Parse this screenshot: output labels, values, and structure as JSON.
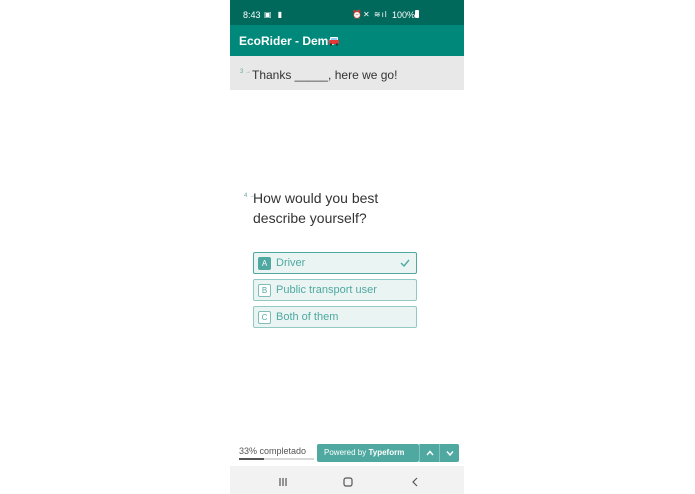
{
  "status_bar": {
    "time": "8:43",
    "left_icons": "▣ ▮",
    "right_icons": "⏰✕ ≋ıl",
    "battery": "100%"
  },
  "app_bar": {
    "title": "EcoRider - Demo",
    "icon": "car-icon",
    "background": "#00897b"
  },
  "previous_question": {
    "number": "3 →",
    "text": "Thanks _____, here we go!"
  },
  "question": {
    "number": "4 →",
    "text": "How would you best describe yourself?",
    "choices": [
      {
        "key": "A",
        "label": "Driver",
        "selected": true
      },
      {
        "key": "B",
        "label": "Public transport user",
        "selected": false
      },
      {
        "key": "C",
        "label": "Both of them",
        "selected": false
      }
    ]
  },
  "footer": {
    "progress_text": "33% completado",
    "progress_value": 0.33,
    "powered_prefix": "Powered by ",
    "powered_brand": "Typeform",
    "accent": "#4fa9a0"
  }
}
